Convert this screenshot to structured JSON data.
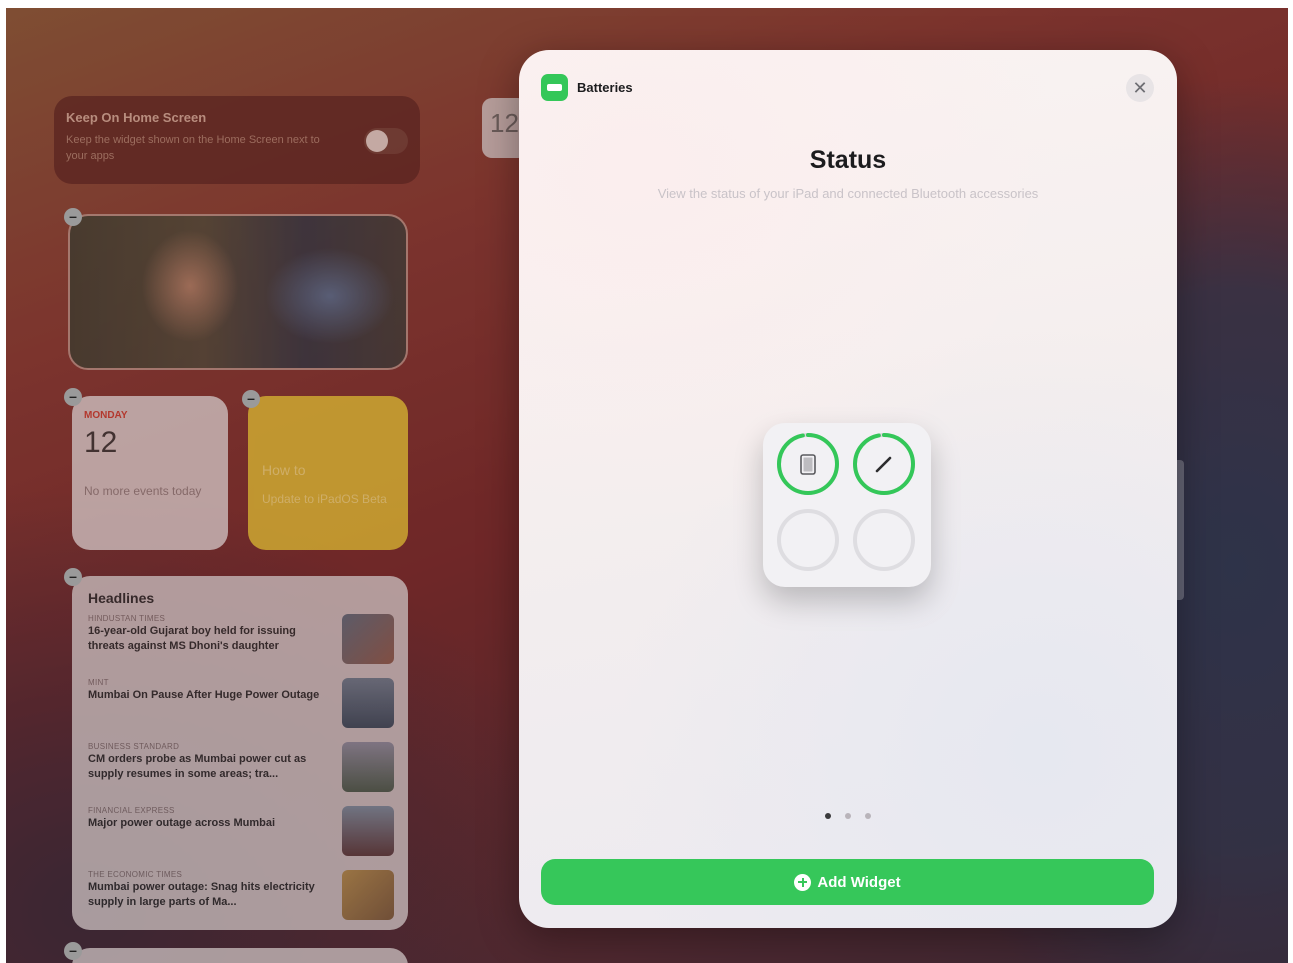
{
  "background_widgets": {
    "keep_on_home": {
      "title": "Keep On Home Screen",
      "description": "Keep the widget shown on the Home Screen next to your apps"
    },
    "calendar": {
      "month": "MONDAY",
      "day": "12",
      "events": "No more events today"
    },
    "calendar_small": {
      "day": "12"
    },
    "notes": {
      "title": "How to",
      "description": "Update to iPadOS Beta"
    },
    "news": {
      "heading": "Headlines",
      "items": [
        {
          "source": "HINDUSTAN TIMES",
          "headline": "16-year-old Gujarat boy held for issuing threats against MS Dhoni's daughter"
        },
        {
          "source": "MINT",
          "headline": "Mumbai On Pause After Huge Power Outage"
        },
        {
          "source": "BUSINESS STANDARD",
          "headline": "CM orders probe as Mumbai power cut as supply resumes in some areas; tra..."
        },
        {
          "source": "FINANCIAL EXPRESS",
          "headline": "Major power outage across Mumbai"
        },
        {
          "source": "THE ECONOMIC TIMES",
          "headline": "Mumbai power outage: Snag hits electricity supply in large parts of Ma..."
        }
      ]
    }
  },
  "sheet": {
    "app_name": "Batteries",
    "close_glyph": "✕",
    "widget_title": "Status",
    "widget_description": "View the status of your iPad and connected Bluetooth accessories",
    "preview": {
      "devices": [
        {
          "icon": "ipad-icon",
          "charge_fraction": 0.97
        },
        {
          "icon": "pencil-icon",
          "charge_fraction": 0.97
        }
      ],
      "empty_slots": 2
    },
    "page_count": 3,
    "active_page": 1,
    "add_button_label": "Add Widget"
  },
  "colors": {
    "accent_green": "#36c75a",
    "app_icon_green": "#34c759"
  }
}
